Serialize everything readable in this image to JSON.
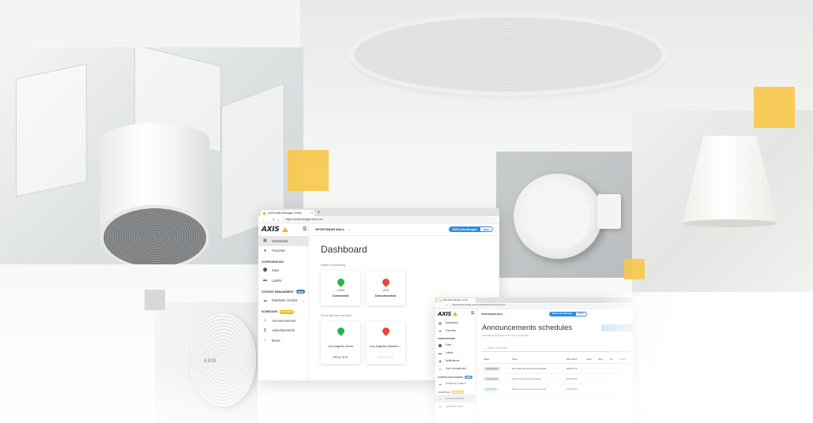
{
  "branding": {
    "logo_text": "AXIS",
    "speaker_marking": "AXIS"
  },
  "colors": {
    "accent_yellow": "#f8c84a",
    "axis_yellow": "#f2b600",
    "primary_blue": "#2d8be0",
    "status_green": "#2bb24c",
    "status_red": "#e5483b"
  },
  "window1": {
    "tab_title": "AXIS Audio Manager Center",
    "tab_favicon": "axis-favicon",
    "url": "https://audiomanager.axis.com/",
    "site_selector": "SPORTSBAR MALL",
    "product_pill": "AXIS Audio Manager",
    "product_pill_secondary": "Basic",
    "sidebar": {
      "items_top": [
        {
          "label": "Dashboard",
          "icon": "dashboard-grid-icon",
          "active": true
        },
        {
          "label": "Favorites",
          "icon": "star-icon",
          "active": false
        }
      ],
      "sections": [
        {
          "title": "CONFIGURATION",
          "badge": "",
          "items": [
            {
              "label": "Sites",
              "icon": "location-pin-icon"
            },
            {
              "label": "Labels",
              "icon": "label-icon"
            }
          ]
        },
        {
          "title": "CONTENT MANAGEMENT",
          "badge": "NEW",
          "items": [
            {
              "label": "Distribute content",
              "icon": "cloud-icon"
            }
          ]
        },
        {
          "title": "SCHEDULES",
          "badge": "PREVIEW",
          "items": [
            {
              "label": "Announcements",
              "icon": "announcement-icon"
            },
            {
              "label": "Advertisements",
              "icon": "dollar-icon"
            },
            {
              "label": "Music",
              "icon": "music-note-icon"
            }
          ]
        }
      ]
    },
    "page_title": "Dashboard",
    "health_heading": "Health monitoring",
    "health_cards": [
      {
        "count": "11/896",
        "label": "Connected",
        "status": "green"
      },
      {
        "count": "1/876",
        "label": "Disconnected",
        "status": "red"
      }
    ],
    "recent_heading": "Recently opened sites",
    "recent_sites": [
      {
        "name": "Los Angeles Store",
        "action": "OPEN SITE",
        "status": "green"
      },
      {
        "name": "Los Angeles Wareho...",
        "action": "OPEN SITE",
        "status": "red"
      }
    ]
  },
  "window2": {
    "tab_title": "AXIS Audio Manager Center",
    "url": "https://audiomanager.axis.com/schedules/announcements",
    "site_selector": "SPORTSBAR MALL",
    "product_pill": "AXIS Audio Manager",
    "product_pill_secondary": "Basic",
    "sidebar": {
      "items_top": [
        {
          "label": "Dashboard",
          "icon": "dashboard-grid-icon"
        },
        {
          "label": "Favorites",
          "icon": "star-icon"
        }
      ],
      "config_title": "CONFIGURATION",
      "config_items": [
        {
          "label": "Sites",
          "icon": "location-pin-icon"
        },
        {
          "label": "Labels",
          "icon": "label-icon"
        },
        {
          "label": "Notifications",
          "icon": "bell-icon"
        },
        {
          "label": "User management",
          "icon": "users-icon"
        }
      ],
      "content_title": "CONTENT MANAGEMENT",
      "content_badge": "NEW",
      "content_items": [
        {
          "label": "Distribute content",
          "icon": "cloud-icon"
        }
      ],
      "schedules_title": "SCHEDULES",
      "schedules_badge": "PREVIEW",
      "schedules_items": [
        {
          "label": "Announcements",
          "icon": "announcement-icon"
        },
        {
          "label": "Advertisements",
          "icon": "dollar-icon"
        }
      ]
    },
    "page_title": "Announcements schedules",
    "page_desc": "Schedule announcements for one or more sites",
    "search_placeholder": "Search schedules",
    "columns": [
      "Status",
      "Name",
      "Date added",
      "Label",
      "Days",
      "Info",
      "Actions"
    ],
    "rows": [
      {
        "status": "SCHEDULED",
        "status_type": "grey",
        "name": "Store office announcements schedule",
        "date": "2023-07-12"
      },
      {
        "status": "SCHEDULED",
        "status_type": "grey",
        "name": "Store announcements schedule",
        "date": "2023-05-02"
      },
      {
        "status": "ACTIVATED",
        "status_type": "green",
        "name": "Warehouse announcements schedule",
        "date": "2023-05-15"
      }
    ]
  }
}
